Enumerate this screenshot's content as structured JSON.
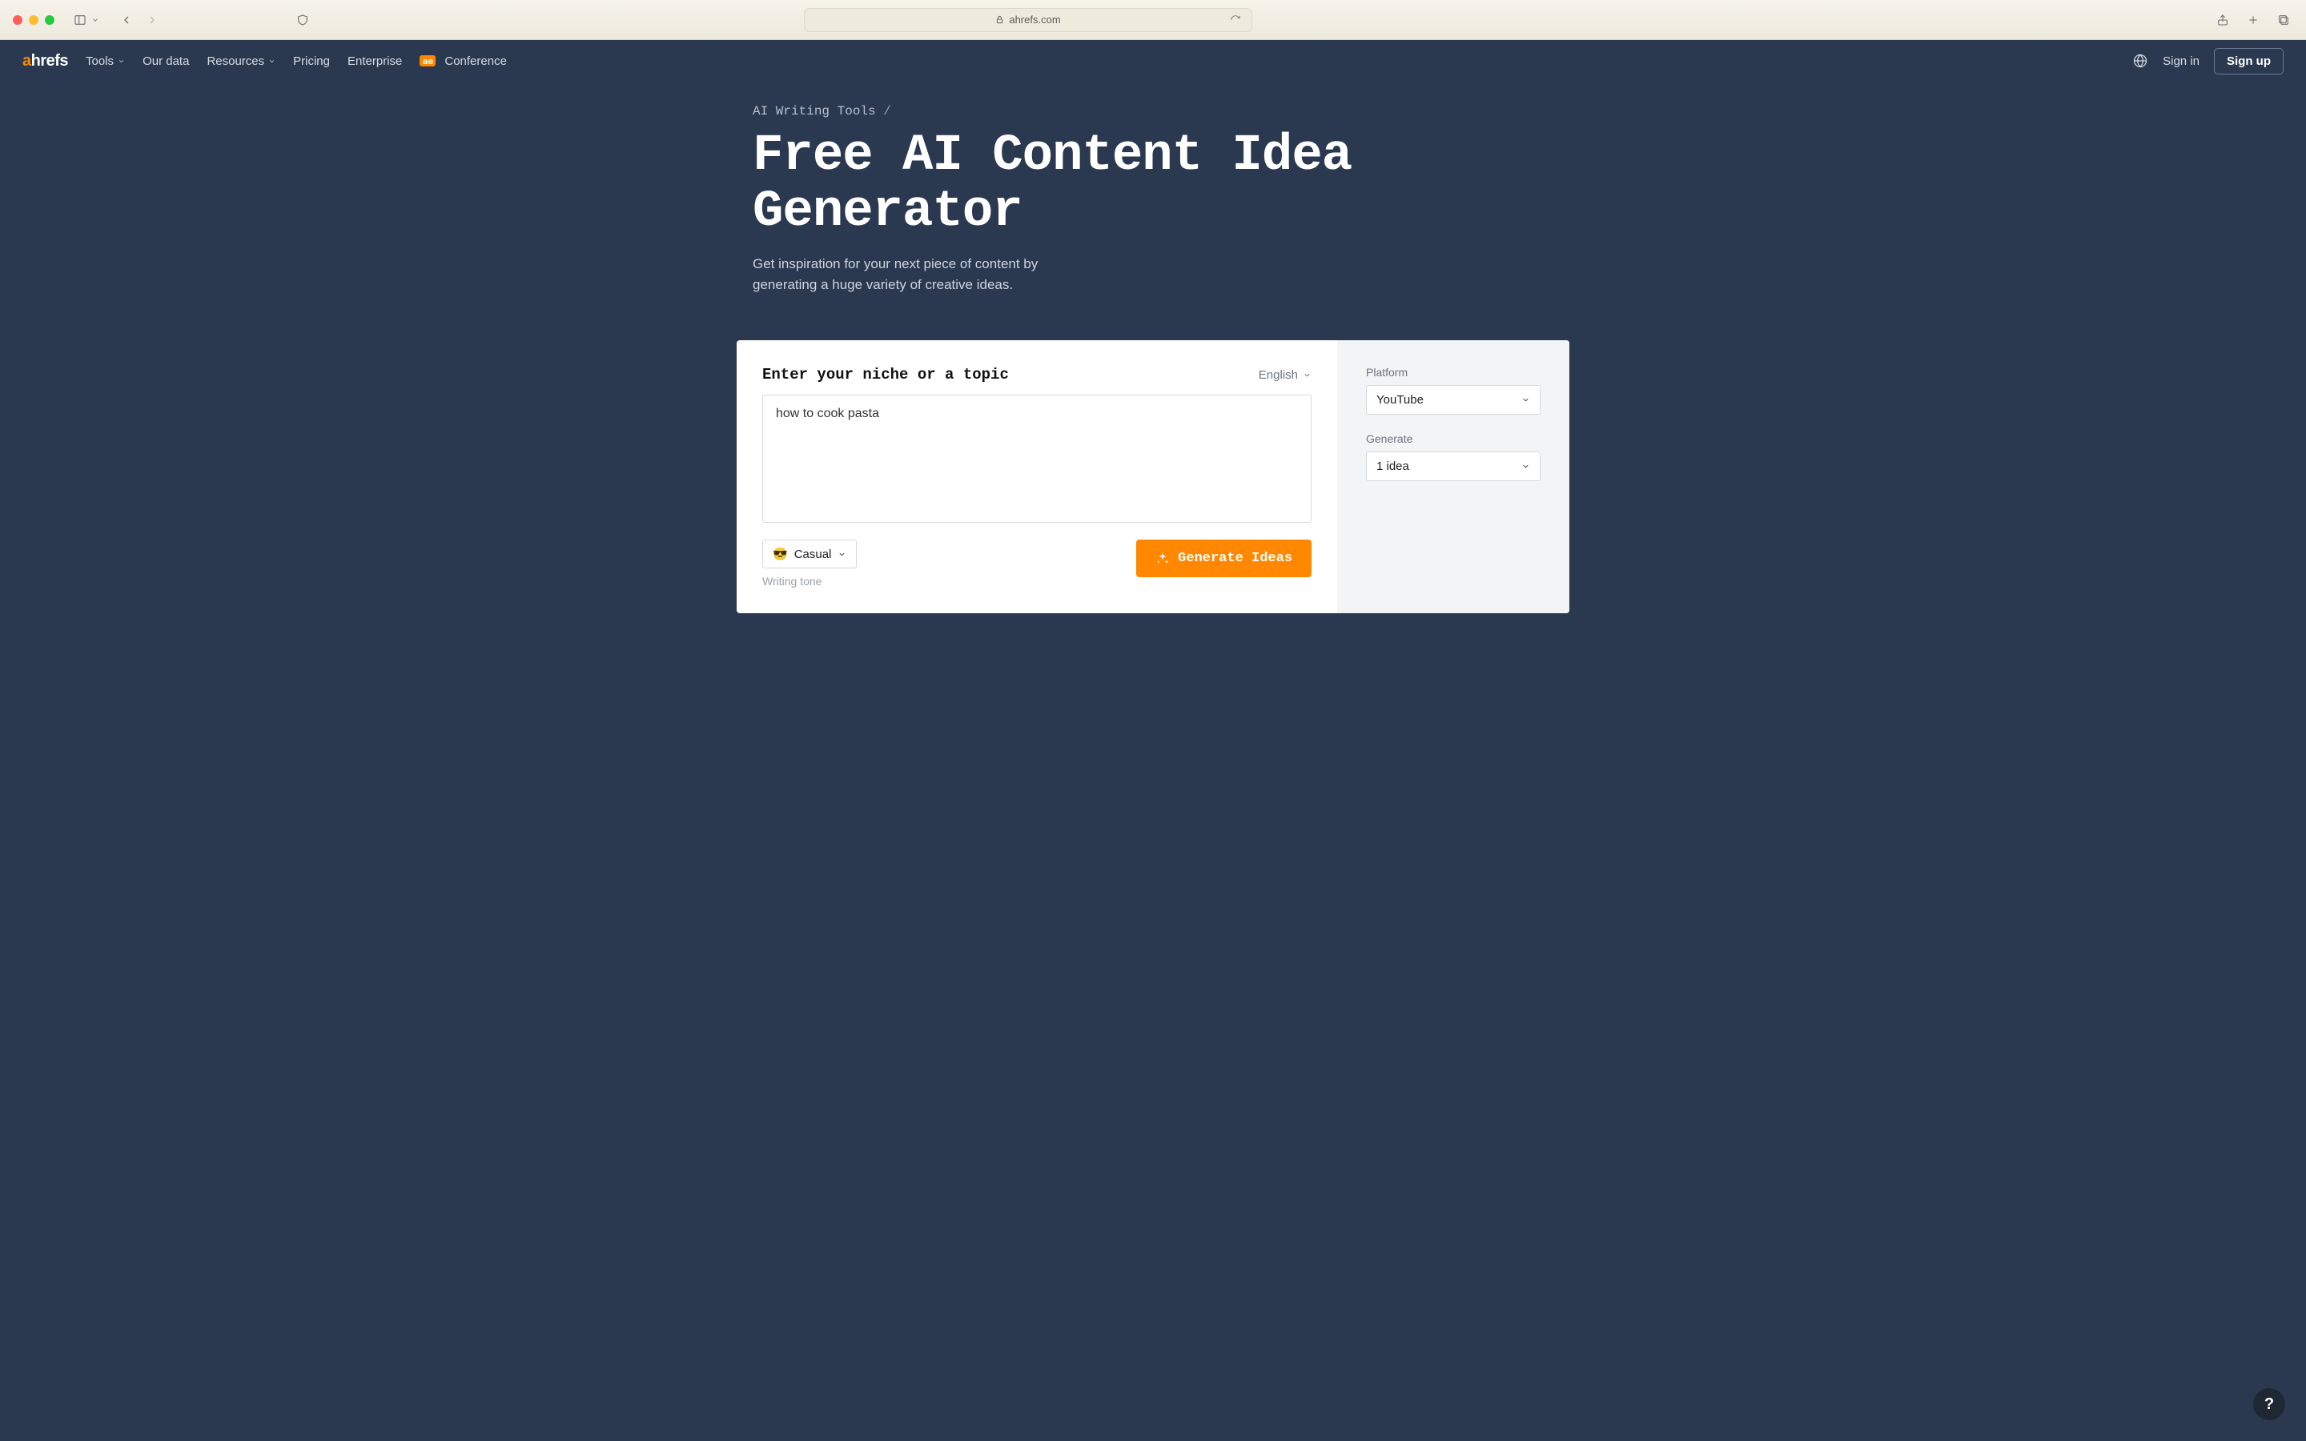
{
  "browser": {
    "url_host": "ahrefs.com"
  },
  "nav": {
    "logo_a": "a",
    "logo_rest": "hrefs",
    "items": [
      {
        "label": "Tools",
        "has_caret": true
      },
      {
        "label": "Our data",
        "has_caret": false
      },
      {
        "label": "Resources",
        "has_caret": true
      },
      {
        "label": "Pricing",
        "has_caret": false
      },
      {
        "label": "Enterprise",
        "has_caret": false
      }
    ],
    "conference_label": "Conference",
    "signin": "Sign in",
    "signup": "Sign up"
  },
  "hero": {
    "breadcrumb_parent": "AI Writing Tools",
    "breadcrumb_sep": " /",
    "title": "Free AI Content Idea Generator",
    "subtitle": "Get inspiration for your next piece of content by generating a huge variety of creative ideas."
  },
  "form": {
    "topic_label": "Enter your niche or a topic",
    "language_label": "English",
    "topic_value": "how to cook pasta",
    "tone_emoji": "😎",
    "tone_value": "Casual",
    "tone_caption": "Writing tone",
    "generate_label": "Generate Ideas"
  },
  "side": {
    "platform_label": "Platform",
    "platform_value": "YouTube",
    "generate_label": "Generate",
    "generate_value": "1 idea"
  },
  "help": {
    "label": "?"
  }
}
